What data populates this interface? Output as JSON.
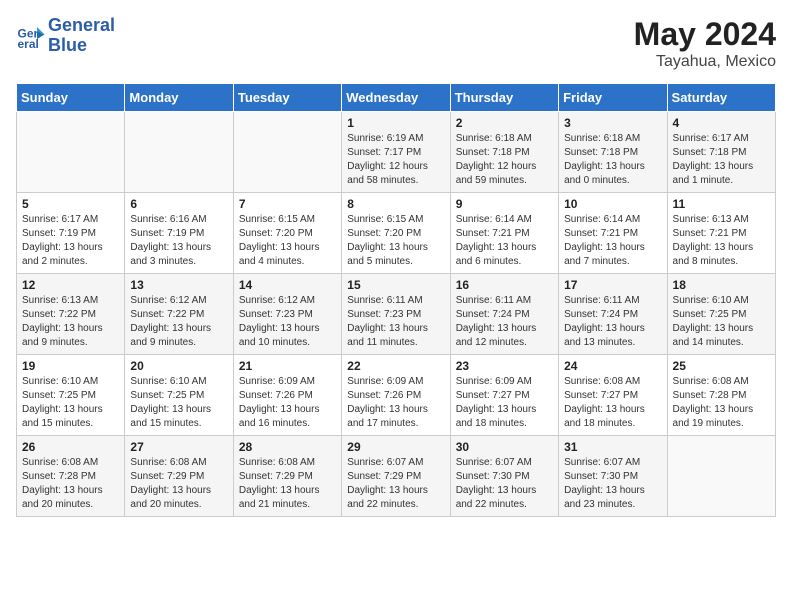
{
  "header": {
    "logo_line1": "General",
    "logo_line2": "Blue",
    "month_year": "May 2024",
    "location": "Tayahua, Mexico"
  },
  "days_of_week": [
    "Sunday",
    "Monday",
    "Tuesday",
    "Wednesday",
    "Thursday",
    "Friday",
    "Saturday"
  ],
  "weeks": [
    [
      {
        "day": "",
        "info": ""
      },
      {
        "day": "",
        "info": ""
      },
      {
        "day": "",
        "info": ""
      },
      {
        "day": "1",
        "info": "Sunrise: 6:19 AM\nSunset: 7:17 PM\nDaylight: 12 hours and 58 minutes."
      },
      {
        "day": "2",
        "info": "Sunrise: 6:18 AM\nSunset: 7:18 PM\nDaylight: 12 hours and 59 minutes."
      },
      {
        "day": "3",
        "info": "Sunrise: 6:18 AM\nSunset: 7:18 PM\nDaylight: 13 hours and 0 minutes."
      },
      {
        "day": "4",
        "info": "Sunrise: 6:17 AM\nSunset: 7:18 PM\nDaylight: 13 hours and 1 minute."
      }
    ],
    [
      {
        "day": "5",
        "info": "Sunrise: 6:17 AM\nSunset: 7:19 PM\nDaylight: 13 hours and 2 minutes."
      },
      {
        "day": "6",
        "info": "Sunrise: 6:16 AM\nSunset: 7:19 PM\nDaylight: 13 hours and 3 minutes."
      },
      {
        "day": "7",
        "info": "Sunrise: 6:15 AM\nSunset: 7:20 PM\nDaylight: 13 hours and 4 minutes."
      },
      {
        "day": "8",
        "info": "Sunrise: 6:15 AM\nSunset: 7:20 PM\nDaylight: 13 hours and 5 minutes."
      },
      {
        "day": "9",
        "info": "Sunrise: 6:14 AM\nSunset: 7:21 PM\nDaylight: 13 hours and 6 minutes."
      },
      {
        "day": "10",
        "info": "Sunrise: 6:14 AM\nSunset: 7:21 PM\nDaylight: 13 hours and 7 minutes."
      },
      {
        "day": "11",
        "info": "Sunrise: 6:13 AM\nSunset: 7:21 PM\nDaylight: 13 hours and 8 minutes."
      }
    ],
    [
      {
        "day": "12",
        "info": "Sunrise: 6:13 AM\nSunset: 7:22 PM\nDaylight: 13 hours and 9 minutes."
      },
      {
        "day": "13",
        "info": "Sunrise: 6:12 AM\nSunset: 7:22 PM\nDaylight: 13 hours and 9 minutes."
      },
      {
        "day": "14",
        "info": "Sunrise: 6:12 AM\nSunset: 7:23 PM\nDaylight: 13 hours and 10 minutes."
      },
      {
        "day": "15",
        "info": "Sunrise: 6:11 AM\nSunset: 7:23 PM\nDaylight: 13 hours and 11 minutes."
      },
      {
        "day": "16",
        "info": "Sunrise: 6:11 AM\nSunset: 7:24 PM\nDaylight: 13 hours and 12 minutes."
      },
      {
        "day": "17",
        "info": "Sunrise: 6:11 AM\nSunset: 7:24 PM\nDaylight: 13 hours and 13 minutes."
      },
      {
        "day": "18",
        "info": "Sunrise: 6:10 AM\nSunset: 7:25 PM\nDaylight: 13 hours and 14 minutes."
      }
    ],
    [
      {
        "day": "19",
        "info": "Sunrise: 6:10 AM\nSunset: 7:25 PM\nDaylight: 13 hours and 15 minutes."
      },
      {
        "day": "20",
        "info": "Sunrise: 6:10 AM\nSunset: 7:25 PM\nDaylight: 13 hours and 15 minutes."
      },
      {
        "day": "21",
        "info": "Sunrise: 6:09 AM\nSunset: 7:26 PM\nDaylight: 13 hours and 16 minutes."
      },
      {
        "day": "22",
        "info": "Sunrise: 6:09 AM\nSunset: 7:26 PM\nDaylight: 13 hours and 17 minutes."
      },
      {
        "day": "23",
        "info": "Sunrise: 6:09 AM\nSunset: 7:27 PM\nDaylight: 13 hours and 18 minutes."
      },
      {
        "day": "24",
        "info": "Sunrise: 6:08 AM\nSunset: 7:27 PM\nDaylight: 13 hours and 18 minutes."
      },
      {
        "day": "25",
        "info": "Sunrise: 6:08 AM\nSunset: 7:28 PM\nDaylight: 13 hours and 19 minutes."
      }
    ],
    [
      {
        "day": "26",
        "info": "Sunrise: 6:08 AM\nSunset: 7:28 PM\nDaylight: 13 hours and 20 minutes."
      },
      {
        "day": "27",
        "info": "Sunrise: 6:08 AM\nSunset: 7:29 PM\nDaylight: 13 hours and 20 minutes."
      },
      {
        "day": "28",
        "info": "Sunrise: 6:08 AM\nSunset: 7:29 PM\nDaylight: 13 hours and 21 minutes."
      },
      {
        "day": "29",
        "info": "Sunrise: 6:07 AM\nSunset: 7:29 PM\nDaylight: 13 hours and 22 minutes."
      },
      {
        "day": "30",
        "info": "Sunrise: 6:07 AM\nSunset: 7:30 PM\nDaylight: 13 hours and 22 minutes."
      },
      {
        "day": "31",
        "info": "Sunrise: 6:07 AM\nSunset: 7:30 PM\nDaylight: 13 hours and 23 minutes."
      },
      {
        "day": "",
        "info": ""
      }
    ]
  ]
}
